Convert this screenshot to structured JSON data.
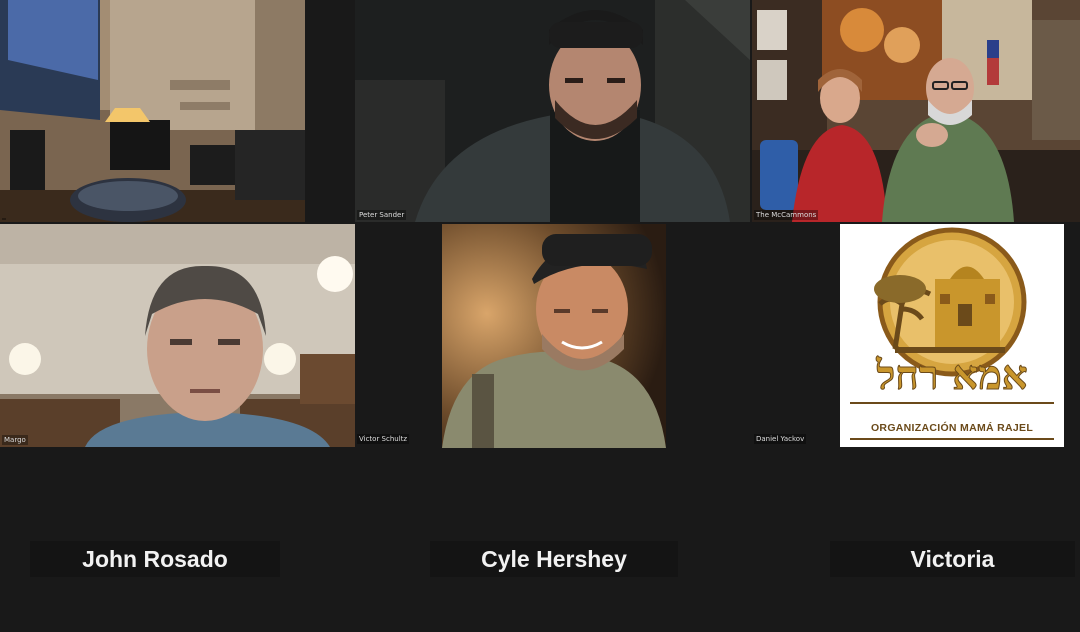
{
  "tiles": {
    "top_left": {
      "name": ""
    },
    "top_center": {
      "name": "Peter Sander"
    },
    "top_right": {
      "name": "The McCammons"
    },
    "mid_left": {
      "name": "Margo"
    },
    "mid_left_gap": {
      "name": "Victor Schultz"
    },
    "mid_center": {
      "name": ""
    },
    "mid_right_gap": {
      "name": "Daniel Yackov"
    },
    "mid_right": {
      "name": "",
      "logo_hebrew": "אמא רחל",
      "logo_text": "ORGANIZACIÓN MAMÁ RAJEL"
    }
  },
  "captions": {
    "left": "John Rosado",
    "center": "Cyle Hershey",
    "right": "Victoria"
  },
  "colors": {
    "background": "#191919",
    "logo_gold": "#c9962c",
    "logo_brown": "#6b4a1a"
  }
}
